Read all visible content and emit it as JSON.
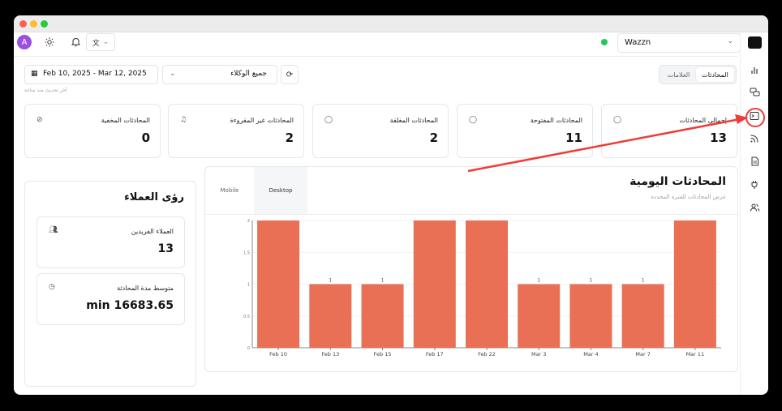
{
  "topbar": {
    "avatar_letter": "A",
    "workspace": "Wazzn"
  },
  "filters": {
    "date_range": "Feb 10, 2025 - Mar 12, 2025",
    "agents": "جميع الوكلاء",
    "last_updated": "آخر تحديث منذ ساعة"
  },
  "view_tabs": {
    "conversations": "المحادثات",
    "labels": "العلامات"
  },
  "stats": [
    {
      "title": "إجمالي المحادثات",
      "value": "13"
    },
    {
      "title": "المحادثات المفتوحة",
      "value": "11"
    },
    {
      "title": "المحادثات المغلقة",
      "value": "2"
    },
    {
      "title": "المحادثات غير المقروءة",
      "value": "2"
    },
    {
      "title": "المحادثات المخفية",
      "value": "0"
    }
  ],
  "insights": {
    "title": "رؤى العملاء",
    "unique_customers_label": "العملاء الفريدين",
    "unique_customers_value": "13",
    "avg_duration_label": "متوسط مدة المحادثة",
    "avg_duration_value": "min 16683.65"
  },
  "chart_card": {
    "title": "المحادثات اليومية",
    "subtitle": "عرض المحادثات للفترة المحددة",
    "tab_mobile": "Mobile",
    "tab_desktop": "Desktop"
  },
  "chart_data": {
    "type": "bar",
    "categories": [
      "Feb 10",
      "Feb 13",
      "Feb 15",
      "Feb 17",
      "Feb 22",
      "Mar 3",
      "Mar 4",
      "Mar 7",
      "Mar 11"
    ],
    "values": [
      2,
      1,
      1,
      2,
      2,
      1,
      1,
      1,
      2
    ],
    "data_labels": [
      "",
      "1",
      "1",
      "",
      "",
      "1",
      "1",
      "1",
      ""
    ],
    "y_ticks": [
      "0",
      "0.5",
      "1",
      "1.5",
      "2"
    ],
    "ylim": [
      0,
      2
    ],
    "bar_color": "#e96f55",
    "grid": true
  },
  "colors": {
    "accent": "#9b51e0",
    "status_online": "#22c55e",
    "annotation": "#ef3b36"
  }
}
